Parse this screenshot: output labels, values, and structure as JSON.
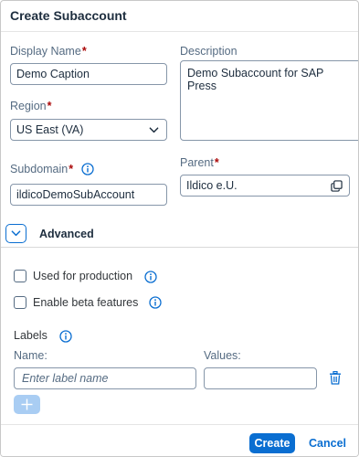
{
  "dialog": {
    "title": "Create Subaccount"
  },
  "form": {
    "display_name": {
      "label": "Display Name",
      "required_mark": "*",
      "value": "Demo Caption"
    },
    "description": {
      "label": "Description",
      "value": "Demo Subaccount for SAP Press"
    },
    "region": {
      "label": "Region",
      "required_mark": "*",
      "value": "US East (VA)"
    },
    "parent": {
      "label": "Parent",
      "required_mark": "*",
      "value": "Ildico e.U."
    },
    "subdomain": {
      "label": "Subdomain",
      "required_mark": "*",
      "value": "ildicoDemoSubAccount"
    }
  },
  "advanced": {
    "label": "Advanced",
    "expanded": true,
    "used_for_production": {
      "label": "Used for production",
      "checked": false
    },
    "enable_beta": {
      "label": "Enable beta features",
      "checked": false
    },
    "labels": {
      "title": "Labels",
      "name_header": "Name:",
      "values_header": "Values:",
      "name_placeholder": "Enter label name",
      "values_value": ""
    }
  },
  "footer": {
    "create_label": "Create",
    "cancel_label": "Cancel"
  },
  "icons": {
    "info": "info-icon",
    "chevron": "chevron-down-icon",
    "copy": "copy-icon",
    "delete": "trash-icon",
    "add": "add-icon"
  },
  "colors": {
    "accent": "#0a6ed1",
    "required": "#aa0808",
    "label": "#556b82",
    "disabled_button": "#a9cdf3"
  }
}
